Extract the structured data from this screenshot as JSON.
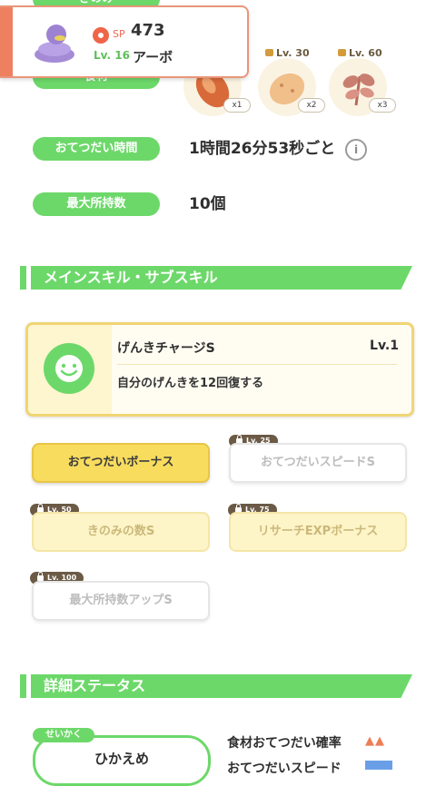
{
  "top": {
    "berry_label": "きのみ",
    "ingredient_label": "食材"
  },
  "pokemon": {
    "sp_label": "SP",
    "sp_value": "473",
    "level": "Lv. 16",
    "name": "アーボ",
    "icon": "arbok-sprite-icon"
  },
  "ingredients": [
    {
      "icon": "sausage-icon",
      "count": "x1",
      "unlock": ""
    },
    {
      "icon": "potato-icon",
      "count": "x2",
      "unlock": "Lv. 30"
    },
    {
      "icon": "herb-icon",
      "count": "x3",
      "unlock": "Lv. 60"
    }
  ],
  "stats": [
    {
      "label": "おてつだい時間",
      "value": "1時間26分53秒ごと"
    },
    {
      "label": "最大所持数",
      "value": "10個"
    }
  ],
  "info_glyph": "i",
  "sections": {
    "skills": "メインスキル・サブスキル",
    "details": "詳細ステータス"
  },
  "main_skill": {
    "name": "げんきチャージS",
    "level": "Lv.1",
    "description": "自分のげんきを12回復する",
    "icon": "smile-face-icon"
  },
  "sub_skills": [
    {
      "label": "おてつだいボーナス",
      "lock": "",
      "state": "active"
    },
    {
      "label": "おてつだいスピードS",
      "lock": "Lv. 25",
      "state": "locked"
    },
    {
      "label": "きのみの数S",
      "lock": "Lv. 50",
      "state": "locked-gold"
    },
    {
      "label": "リサーチEXPボーナス",
      "lock": "Lv. 75",
      "state": "locked-gold"
    },
    {
      "label": "最大所持数アップS",
      "lock": "Lv. 100",
      "state": "locked"
    }
  ],
  "details": {
    "nature_label": "せいかく",
    "nature_value": "ひかえめ",
    "rows": [
      {
        "label": "食材おてつだい確率",
        "marks": "▲▲",
        "color": "#ee7d55"
      },
      {
        "label": "おてつだいスピード",
        "marks": "",
        "color": "#6a9fe8"
      }
    ]
  },
  "colors": {
    "accent_green": "#6dd86a",
    "gold": "#f7dc5e",
    "orange": "#ee8060"
  }
}
